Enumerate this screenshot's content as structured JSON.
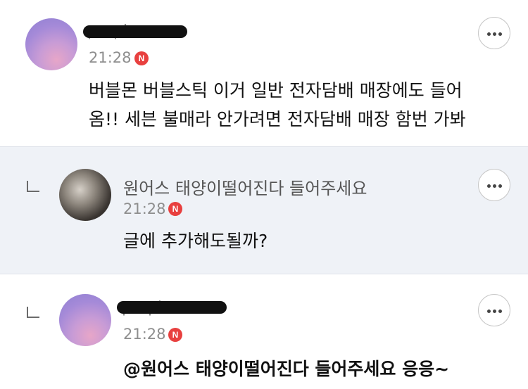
{
  "comments": [
    {
      "name": "purple",
      "name_redacted": true,
      "time": "21:28",
      "badge": "N",
      "text_lines": [
        "버블몬 버블스틱 이거 일반 전자담배 매장에도 들어",
        "옴!! 세븐 불매라 안가려면 전자담배 매장 함번 가봐"
      ],
      "is_reply": false
    },
    {
      "name": "원어스 태양이떨어진다 들어주세요",
      "name_redacted": false,
      "time": "21:28",
      "badge": "N",
      "text_lines": [
        "글에 추가해도될까?"
      ],
      "is_reply": true
    },
    {
      "name": "purple",
      "name_redacted": true,
      "time": "21:28",
      "badge": "N",
      "text_lines": [
        "@원어스 태양이떨어진다 들어주세요  응응~"
      ],
      "is_reply": true
    }
  ],
  "icons": {
    "more": "more-options-icon",
    "reply": "reply-indent-icon",
    "new": "new-badge"
  },
  "colors": {
    "badge": "#e8403f",
    "highlight_bg": "#eff2f7"
  }
}
